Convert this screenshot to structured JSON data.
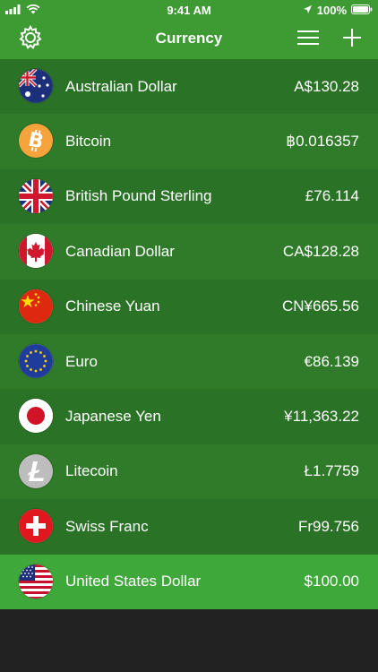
{
  "status_bar": {
    "time": "9:41 AM",
    "battery": "100%"
  },
  "nav": {
    "title": "Currency",
    "left_icon": "gear-icon",
    "right_icons": [
      "menu-icon",
      "plus-icon"
    ]
  },
  "currencies": [
    {
      "name": "Australian Dollar",
      "amount": "A$130.28",
      "icon": "australia-flag-icon"
    },
    {
      "name": "Bitcoin",
      "amount": "฿0.016357",
      "icon": "bitcoin-icon"
    },
    {
      "name": "British Pound Sterling",
      "amount": "£76.114",
      "icon": "uk-flag-icon"
    },
    {
      "name": "Canadian Dollar",
      "amount": "CA$128.28",
      "icon": "canada-flag-icon"
    },
    {
      "name": "Chinese Yuan",
      "amount": "CN¥665.56",
      "icon": "china-flag-icon"
    },
    {
      "name": "Euro",
      "amount": "€86.139",
      "icon": "eu-flag-icon"
    },
    {
      "name": "Japanese Yen",
      "amount": "¥11,363.22",
      "icon": "japan-flag-icon"
    },
    {
      "name": "Litecoin",
      "amount": "Ł1.7759",
      "icon": "litecoin-icon"
    },
    {
      "name": "Swiss Franc",
      "amount": "Fr99.756",
      "icon": "switzerland-flag-icon"
    },
    {
      "name": "United States Dollar",
      "amount": "$100.00",
      "icon": "us-flag-icon"
    }
  ],
  "colors": {
    "accent": "#3fa83a",
    "row_dark": "#2a7226",
    "row_mid": "#2f7b29",
    "bottom": "#222222"
  }
}
